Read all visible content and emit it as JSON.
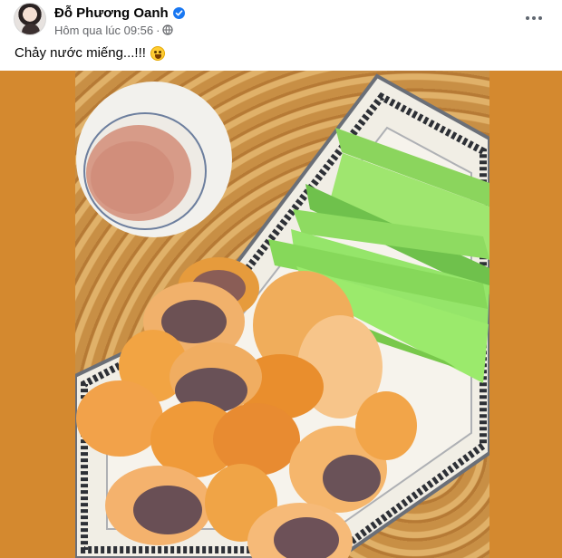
{
  "post": {
    "author": "Đỗ Phương Oanh",
    "verified": true,
    "timestamp": "Hôm qua lúc 09:56",
    "separator": "·",
    "privacy_icon": "globe-icon",
    "more_icon": "more-options-icon",
    "caption": "Chảy nước miếng...!!!",
    "caption_emoji": "drooling-face-emoji"
  },
  "photo": {
    "subject": "photo",
    "background_color": "#d4892f",
    "accent_color": "#1877f2"
  }
}
